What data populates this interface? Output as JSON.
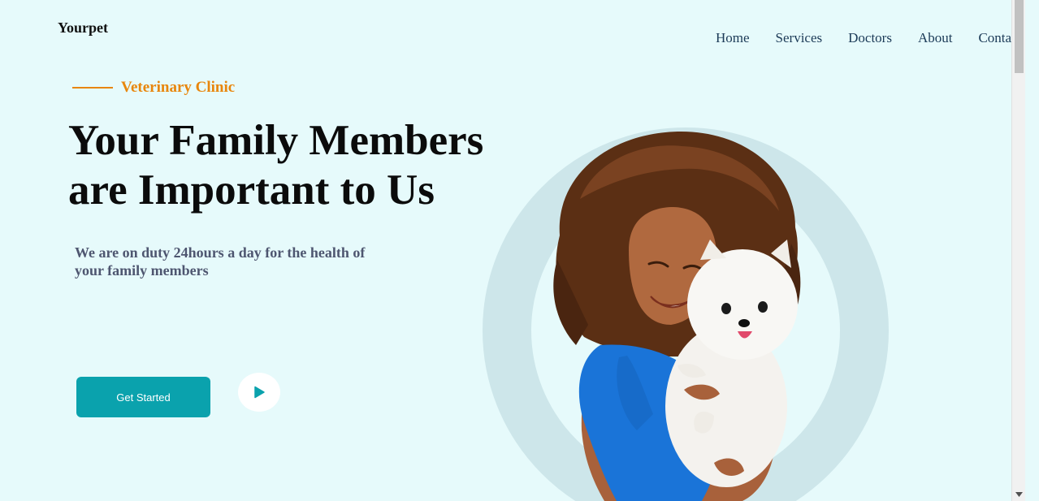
{
  "brand": {
    "logo": "Yourpet"
  },
  "nav": {
    "items": [
      "Home",
      "Services",
      "Doctors",
      "About",
      "Contact"
    ]
  },
  "hero": {
    "eyebrow": "Veterinary Clinic",
    "headline_line1": "Your Family Members",
    "headline_line2": "are Important to Us",
    "subtext": "We are on duty 24hours a day for the health of your family members",
    "cta_label": "Get Started",
    "play_icon": "play-icon",
    "image_subject": "woman-hugging-pomeranian"
  },
  "colors": {
    "background": "#e6fafb",
    "accent_orange": "#e8860c",
    "primary_teal": "#0aa2ad",
    "ring": "#cde6ea",
    "nav_text": "#1b3a57",
    "subtext": "#4e5670"
  }
}
